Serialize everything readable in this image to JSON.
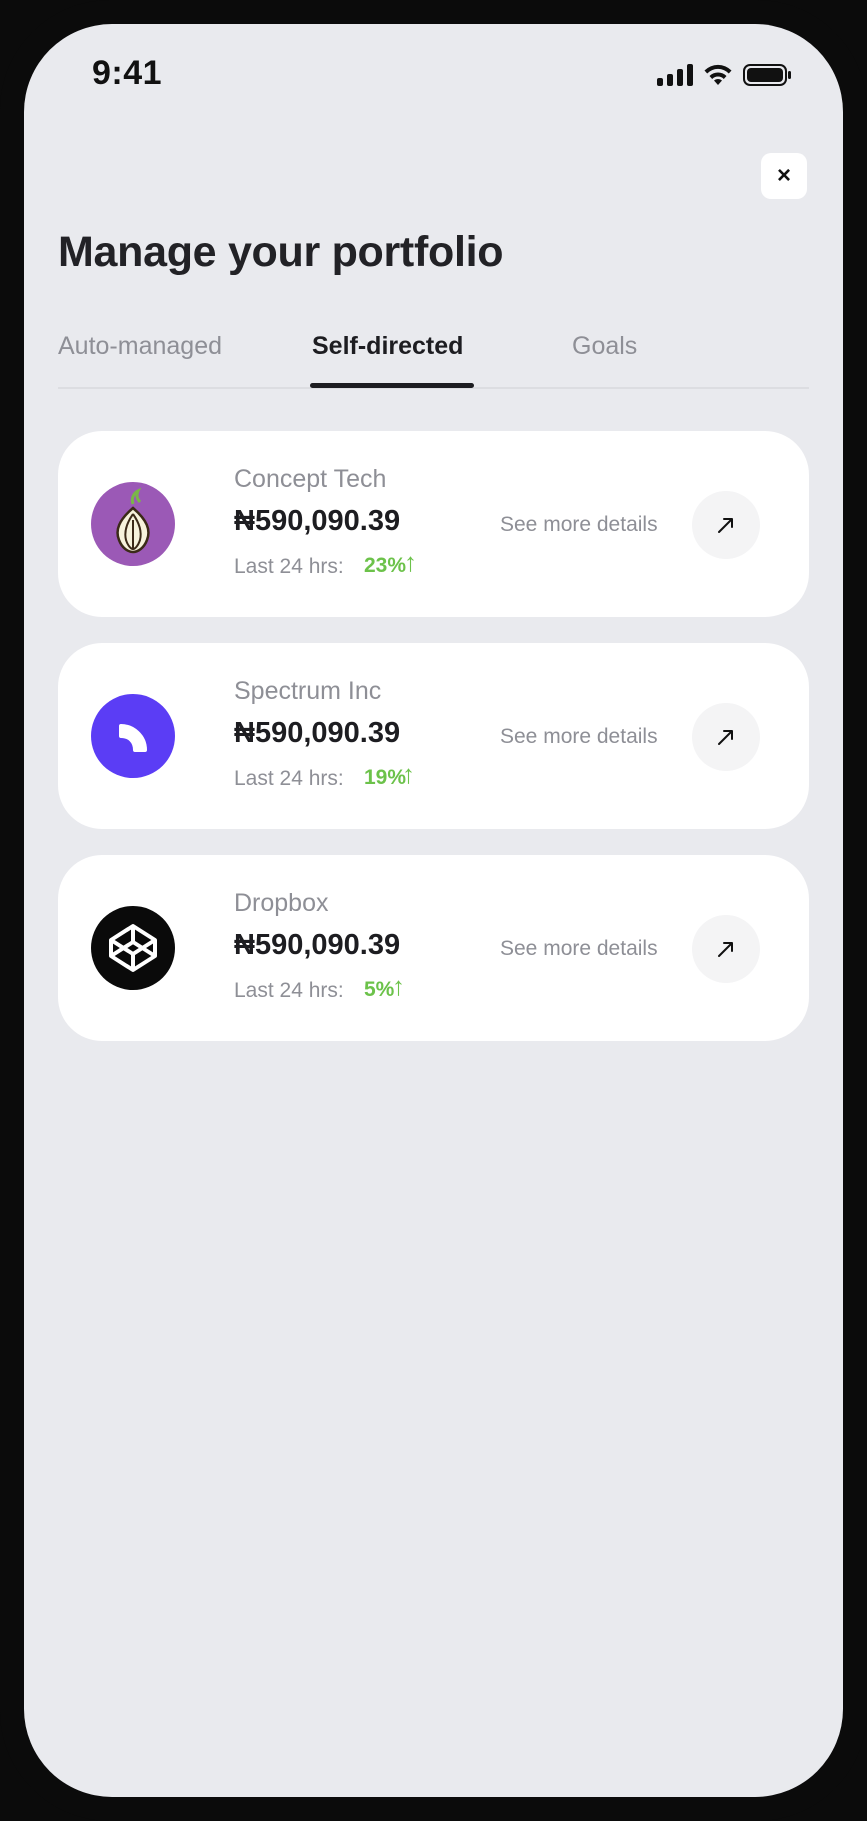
{
  "status_bar": {
    "time": "9:41"
  },
  "page": {
    "title": "Manage your portfolio",
    "close_label": "×"
  },
  "tabs": [
    {
      "label": "Auto-managed",
      "active": false
    },
    {
      "label": "Self-directed",
      "active": true
    },
    {
      "label": "Goals",
      "active": false
    }
  ],
  "holdings": [
    {
      "name": "Concept Tech",
      "value": "₦590,090.39",
      "change_label": "Last 24 hrs:",
      "change": "23%",
      "change_icon": "↑",
      "details_label": "See more details",
      "logo": "onion-logo-icon"
    },
    {
      "name": "Spectrum Inc",
      "value": "₦590,090.39",
      "change_label": "Last 24 hrs:",
      "change": "19%",
      "change_icon": "↑",
      "details_label": "See more details",
      "logo": "spectrum-logo-icon"
    },
    {
      "name": "Dropbox",
      "value": "₦590,090.39",
      "change_label": "Last 24 hrs:",
      "change": "5%",
      "change_icon": "↑",
      "details_label": "See more details",
      "logo": "codepen-logo-icon"
    }
  ],
  "colors": {
    "positive": "#6cc24a",
    "text_primary": "#1d1d21",
    "text_secondary": "#8e8f96",
    "background": "#e9eaee"
  }
}
